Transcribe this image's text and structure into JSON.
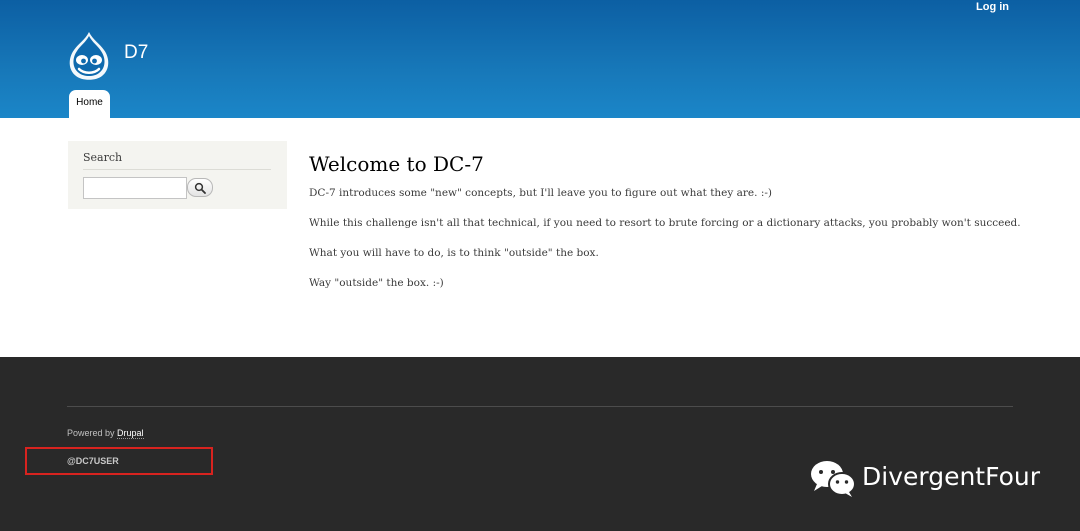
{
  "header": {
    "login_label": "Log in",
    "site_name": "D7",
    "logo_icon": "drupal-drop-icon",
    "tabs": [
      {
        "label": "Home",
        "active": true
      }
    ],
    "colors": {
      "header_top": "#0c5fa3",
      "header_bottom": "#1b86c8"
    }
  },
  "sidebar": {
    "search_title": "Search",
    "search_input_value": "",
    "search_button_icon": "search-icon"
  },
  "main": {
    "title": "Welcome to DC-7",
    "paragraphs": [
      "DC-7 introduces some \"new\" concepts, but I'll leave you to figure out what they are.  :-)",
      "While this challenge isn't all that technical, if you need to resort to brute forcing or a dictionary attacks, you probably won't succeed.",
      "What you will have to do, is to think \"outside\" the box.",
      "Way \"outside\" the box.  :-)"
    ]
  },
  "footer": {
    "powered_by_prefix": "Powered by ",
    "powered_by_link": "Drupal",
    "username": "@DC7USER",
    "highlight_color": "#d8231f"
  },
  "watermark": {
    "icon": "wechat-icon",
    "text": "DivergentFour"
  }
}
